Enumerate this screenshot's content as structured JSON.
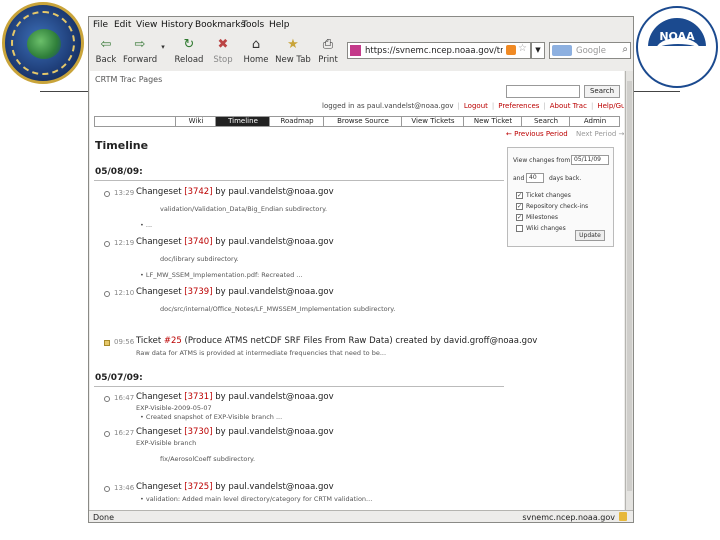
{
  "slide": {
    "left_logo": {
      "name": "satellite-center-seal-logo"
    },
    "right_logo": {
      "name": "noaa-logo",
      "text": "NOAA"
    }
  },
  "browser": {
    "menu": [
      "File",
      "Edit",
      "View",
      "History",
      "Bookmarks",
      "Tools",
      "Help"
    ],
    "toolbar": {
      "back": "Back",
      "forward": "Forward",
      "reload": "Reload",
      "stop": "Stop",
      "home": "Home",
      "new_tab": "New Tab",
      "print": "Print"
    },
    "url": "https://svnemc.ncep.noaa.gov/trac/crtm",
    "search_placeholder": "Google",
    "status_left": "Done",
    "status_right": "svnemc.ncep.noaa.gov"
  },
  "trac": {
    "project_title": "CRTM Trac Pages",
    "search_button": "Search",
    "logged_in": "logged in as paul.vandelst@noaa.gov",
    "metanav": [
      "Logout",
      "Preferences",
      "About Trac",
      "Help/Guide"
    ],
    "nav_tabs": [
      "Wiki",
      "Timeline",
      "Roadmap",
      "Browse Source",
      "View Tickets",
      "New Ticket",
      "Search",
      "Admin"
    ],
    "active_tab": "Timeline",
    "prev_period": "← Previous Period",
    "next_period": "Next Period →",
    "page_title": "Timeline",
    "prefs": {
      "view_changes_from": "View changes from",
      "from_date": "05/11/09",
      "and_label": "and",
      "days": "40",
      "days_back": "days back.",
      "filters": [
        {
          "label": "Ticket changes",
          "checked": true
        },
        {
          "label": "Repository check-ins",
          "checked": true
        },
        {
          "label": "Milestones",
          "checked": true
        },
        {
          "label": "Wiki changes",
          "checked": false
        }
      ],
      "update": "Update"
    },
    "days": [
      {
        "date": "05/08/09:",
        "events": [
          {
            "time": "13:29",
            "title_pre": "Changeset ",
            "num": "[3742]",
            "title_post": " by paul.vandelst@noaa.gov",
            "line1": "validation/Validation_Data/Big_Endian subdirectory.",
            "line2": "• ..."
          },
          {
            "time": "12:19",
            "title_pre": "Changeset ",
            "num": "[3740]",
            "title_post": " by paul.vandelst@noaa.gov",
            "line1": "doc/library subdirectory.",
            "line2": "• LF_MW_SSEM_Implementation.pdf: Recreated ..."
          },
          {
            "time": "12:10",
            "title_pre": "Changeset ",
            "num": "[3739]",
            "title_post": " by paul.vandelst@noaa.gov",
            "line1": "doc/src/internal/Office_Notes/LF_MWSSEM_Implementation subdirectory.",
            "line2": ""
          },
          {
            "time": "09:56",
            "ticket": true,
            "title_pre": "Ticket ",
            "num": "#25",
            "title_post": " (Produce ATMS netCDF SRF Files From Raw Data) created by david.groff@noaa.gov",
            "line1": "Raw data for ATMS is provided at intermediate frequencies that need to be...",
            "line2": ""
          }
        ]
      },
      {
        "date": "05/07/09:",
        "events": [
          {
            "time": "16:47",
            "title_pre": "Changeset ",
            "num": "[3731]",
            "title_post": " by paul.vandelst@noaa.gov",
            "line1": "EXP-Visible-2009-05-07",
            "line2": "• Created snapshot of EXP-Visible branch ..."
          },
          {
            "time": "16:27",
            "title_pre": "Changeset ",
            "num": "[3730]",
            "title_post": " by paul.vandelst@noaa.gov",
            "line1": "EXP-Visible branch",
            "line2": "fix/AerosolCoeff subdirectory."
          },
          {
            "time": "13:46",
            "title_pre": "Changeset ",
            "num": "[3725]",
            "title_post": " by paul.vandelst@noaa.gov",
            "line1": "• validation: Added main level directory/category for CRTM validation...",
            "line2": ""
          }
        ]
      }
    ]
  }
}
